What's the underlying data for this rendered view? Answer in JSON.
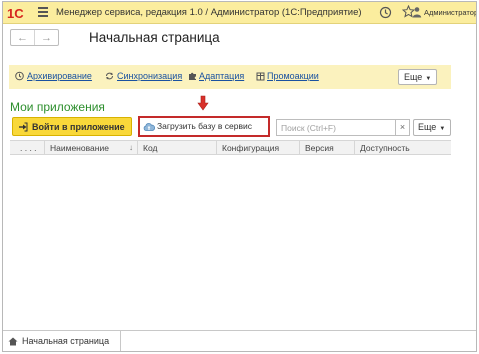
{
  "titlebar": {
    "logo_text": "1С",
    "title": "Менеджер сервиса, редакция 1.0 / Администратор  (1С:Предприятие)",
    "user": "Администратор"
  },
  "nav": {
    "back": "←",
    "forward": "→",
    "page_title": "Начальная страница"
  },
  "commands": {
    "archiving": "Архивирование",
    "sync": "Синхронизация",
    "adaptation": "Адаптация",
    "promo": "Промоакции",
    "more": "Еще"
  },
  "section": {
    "title": "Мои приложения",
    "login_button": "Войти в приложение",
    "upload_button": "Загрузить базу в сервис",
    "search_placeholder": "Поиск (Ctrl+F)",
    "search_clear": "×",
    "more": "Еще"
  },
  "table": {
    "columns": {
      "dots": ". . . .",
      "name": "Наименование",
      "code": "Код",
      "config": "Конфигурация",
      "version": "Версия",
      "access": "Доступность"
    },
    "rows": []
  },
  "bottom": {
    "tab_label": "Начальная страница"
  },
  "colors": {
    "titlebar_bg": "#fbed9e",
    "command_bar_bg": "#fbf2be",
    "primary_button": "#f9d83a",
    "section_title": "#2d8f2d",
    "highlight_box": "#c42a2a",
    "link": "#1a52a0"
  }
}
